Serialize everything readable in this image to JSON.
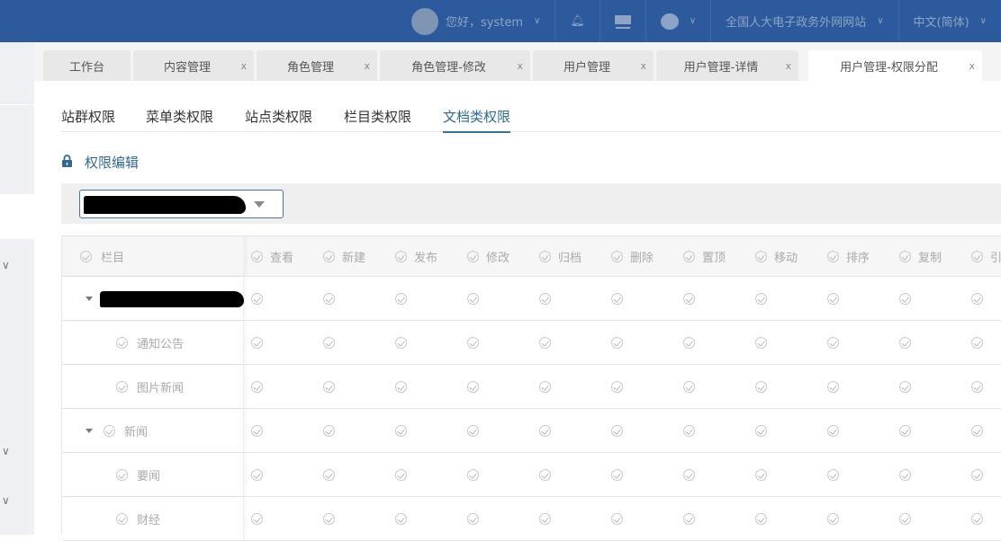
{
  "header": {
    "greeting": "您好，system",
    "site": "全国人大电子政务外网网站",
    "language": "中文(简体)"
  },
  "tabs": [
    {
      "label": "工作台",
      "closable": false
    },
    {
      "label": "内容管理",
      "closable": true
    },
    {
      "label": "角色管理",
      "closable": true
    },
    {
      "label": "角色管理-修改",
      "closable": true
    },
    {
      "label": "用户管理",
      "closable": true
    },
    {
      "label": "用户管理-详情",
      "closable": true
    },
    {
      "label": "用户管理-权限分配",
      "closable": true,
      "active": true
    }
  ],
  "close_glyph": "x",
  "subtabs": [
    "站群权限",
    "菜单类权限",
    "站点类权限",
    "栏目类权限",
    "文档类权限"
  ],
  "active_subtab": "文档类权限",
  "section_title": "权限编辑",
  "table": {
    "first_header": "栏目",
    "columns": [
      "查看",
      "新建",
      "发布",
      "修改",
      "归档",
      "删除",
      "置顶",
      "移动",
      "排序",
      "复制",
      "引"
    ],
    "rows": [
      {
        "label": "",
        "level": 0,
        "expandable": true,
        "redacted": true
      },
      {
        "label": "通知公告",
        "level": 1
      },
      {
        "label": "图片新闻",
        "level": 1
      },
      {
        "label": "新闻",
        "level": 0,
        "expandable": true
      },
      {
        "label": "要闻",
        "level": 1
      },
      {
        "label": "财经",
        "level": 1
      }
    ]
  }
}
